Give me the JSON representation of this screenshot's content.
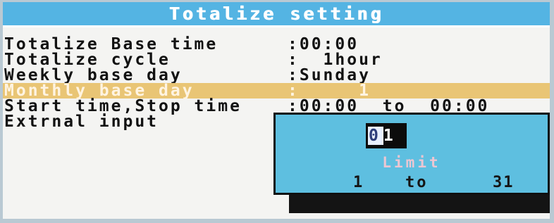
{
  "title": "Totalize setting",
  "settings": [
    {
      "label": "Totalize Base time",
      "value": ":00:00"
    },
    {
      "label": "Totalize cycle",
      "value": ":  1hour"
    },
    {
      "label": "Weekly base day",
      "value": ":Sunday"
    },
    {
      "label": "Monthly base day",
      "value": ":     1"
    },
    {
      "label": "Start time,Stop time",
      "value": ":00:00  to  00:00"
    },
    {
      "label": "Extrnal input",
      "value": ""
    }
  ],
  "selected_index": 3,
  "input_popup": {
    "cursor_digit": "0",
    "rest_digits": "1",
    "limit_label": "Limit",
    "min": "1",
    "to_label": "to",
    "max": "31"
  },
  "colors": {
    "title_bar": "#54b4e3",
    "highlight_row": "#e9c575",
    "popup_background": "#5ebfe0"
  }
}
